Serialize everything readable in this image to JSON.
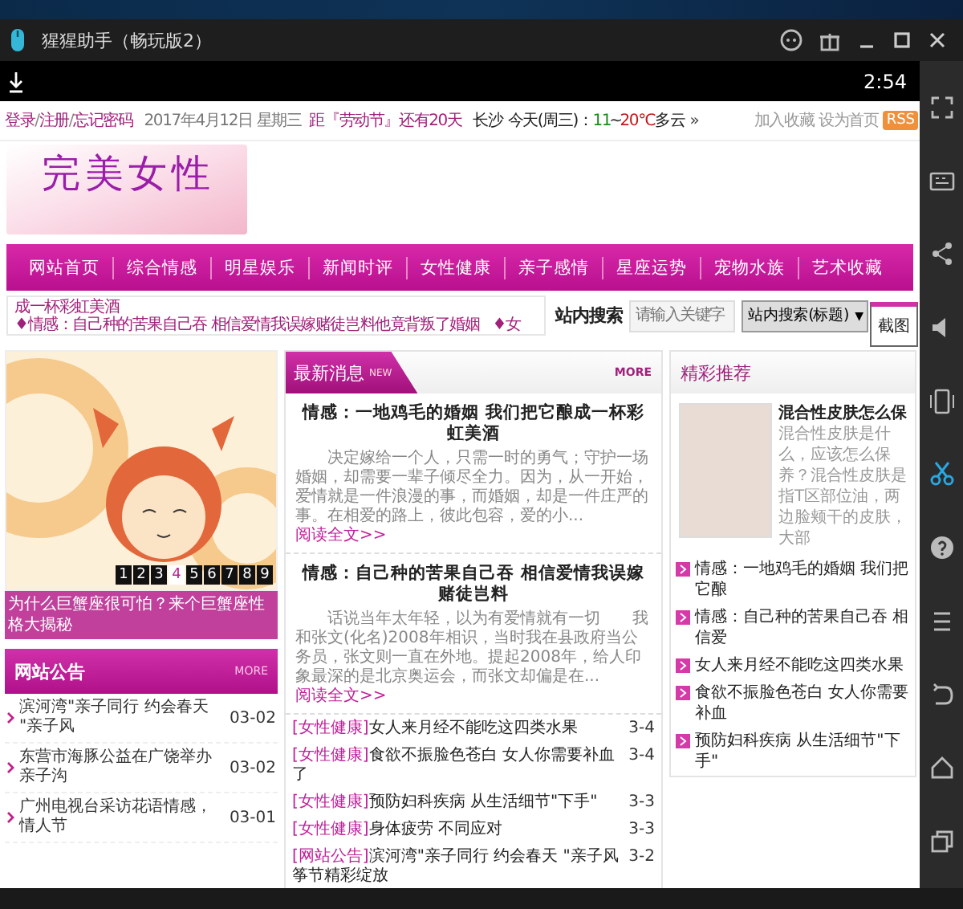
{
  "window": {
    "title": "猩猩助手（畅玩版2）"
  },
  "status_bar": {
    "time": "2:54"
  },
  "side_toolbar": {
    "tooltip": "截图"
  },
  "top_bar": {
    "account_links": [
      "登录",
      "注册",
      "忘记密码"
    ],
    "separator": "/",
    "date": "2017年4月12日 星期三",
    "countdown": "距『劳动节』还有20天",
    "weather": {
      "city": "长沙",
      "label": "今天(周三)：",
      "low": "11",
      "sep": "~",
      "high": "20℃",
      "condition": "多云",
      "more": "»"
    },
    "links": [
      "加入收藏",
      "设为首页"
    ],
    "rss": "RSS"
  },
  "logo": "完美女性",
  "nav": [
    "网站首页",
    "综合情感",
    "明星娱乐",
    "新闻时评",
    "女性健康",
    "亲子感情",
    "星座运势",
    "宠物水族",
    "艺术收藏"
  ],
  "ticker": [
    "成一杯彩虹美酒",
    "♦情感：自己种的苦果自己吞 相信爱情我误嫁赌徒岂料他竟背叛了婚姻",
    "♦女"
  ],
  "search": {
    "label": "站内搜索",
    "placeholder": "请输入关键字",
    "scope": "站内搜索(标题)",
    "caret": "▼"
  },
  "featured": {
    "pages": [
      {
        "label": "1",
        "selected": false
      },
      {
        "label": "2",
        "selected": false
      },
      {
        "label": "3",
        "selected": false
      },
      {
        "label": "4",
        "selected": true
      },
      {
        "label": "5",
        "selected": false
      },
      {
        "label": "6",
        "selected": false
      },
      {
        "label": "7",
        "selected": false
      },
      {
        "label": "8",
        "selected": false
      },
      {
        "label": "9",
        "selected": false
      }
    ],
    "caption": "为什么巨蟹座很可怕？来个巨蟹座性格大揭秘"
  },
  "notices": {
    "title": "网站公告",
    "more": "MORE",
    "items": [
      {
        "title": "滨河湾\"亲子同行 约会春天 \"亲子风",
        "date": "03-02"
      },
      {
        "title": "东营市海豚公益在广饶举办亲子沟",
        "date": "03-02"
      },
      {
        "title": "广州电视台采访花语情感，情人节",
        "date": "03-01"
      }
    ]
  },
  "news": {
    "title": "最新消息",
    "badge": "NEW",
    "more": "MORE",
    "articles": [
      {
        "title": "情感：一地鸡毛的婚姻 我们把它酿成一杯彩虹美酒",
        "summary": "决定嫁给一个人，只需一时的勇气；守护一场婚姻，却需要一辈子倾尽全力。因为，从一开始，爱情就是一件浪漫的事，而婚姻，却是一件庄严的事。在相爱的路上，彼此包容，爱的小...",
        "read_more": "阅读全文>>"
      },
      {
        "title": "情感：自己种的苦果自己吞 相信爱情我误嫁赌徒岂料",
        "summary": "话说当年太年轻，以为有爱情就有一切　　我和张文(化名)2008年相识，当时我在县政府当公务员，张文则一直在外地。提起2008年，给人印象最深的是北京奥运会，而张文却偏是在...",
        "read_more": "阅读全文>>"
      }
    ],
    "items": [
      {
        "category": "[女性健康]",
        "title": "女人来月经不能吃这四类水果",
        "date": "3-4"
      },
      {
        "category": "[女性健康]",
        "title": "食欲不振脸色苍白 女人你需要补血了",
        "date": "3-4"
      },
      {
        "category": "[女性健康]",
        "title": "预防妇科疾病 从生活细节\"下手\"",
        "date": "3-3"
      },
      {
        "category": "[女性健康]",
        "title": "身体疲劳 不同应对",
        "date": "3-3"
      },
      {
        "category": "[网站公告]",
        "title": "滨河湾\"亲子同行 约会春天 \"亲子风筝节精彩绽放",
        "date": "3-2"
      }
    ]
  },
  "picks": {
    "title": "精彩推荐",
    "feature": {
      "title": "混合性皮肤怎么保",
      "summary": "混合性皮肤是什么，应该怎么保养？混合性皮肤是指T区部位油，两边脸颊干的皮肤，大部"
    },
    "items": [
      "情感：一地鸡毛的婚姻 我们把它酿",
      "情感：自己种的苦果自己吞 相信爱",
      "女人来月经不能吃这四类水果",
      "食欲不振脸色苍白 女人你需要补血",
      "预防妇科疾病 从生活细节\"下手\""
    ]
  }
}
